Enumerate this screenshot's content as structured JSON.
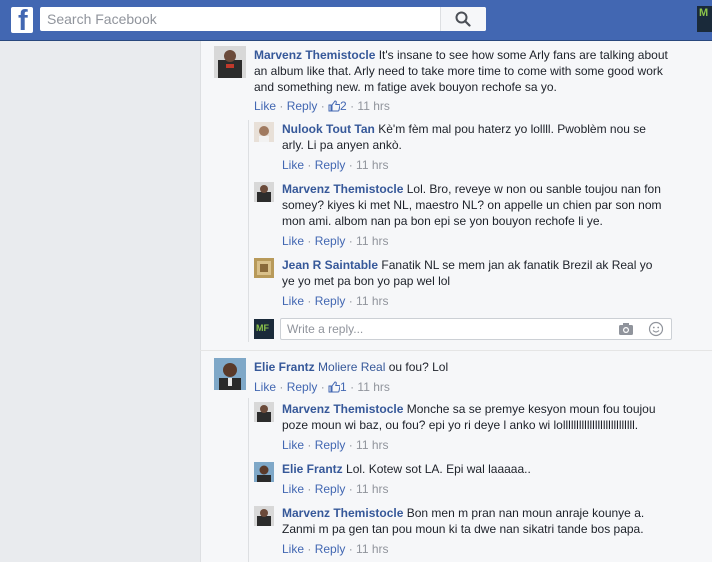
{
  "header": {
    "logo": "f",
    "search_placeholder": "Search Facebook",
    "profile_text": "M"
  },
  "comments": [
    {
      "author": "Marvenz Themistocle",
      "text": "It's insane to see how some Arly fans are talking about an album like that. Arly need to take more time to come with some good work and something new. m fatige avek bouyon rechofe sa yo.",
      "like": "Like",
      "reply": "Reply",
      "reactions": "2",
      "time": "11 hrs"
    },
    {
      "author": "Nulook Tout Tan",
      "text": "Kè'm fèm mal pou haterz yo lollll. Pwoblèm nou se arly. Li pa anyen ankò.",
      "like": "Like",
      "reply": "Reply",
      "time": "11 hrs"
    },
    {
      "author": "Marvenz Themistocle",
      "text": "Lol. Bro, reveye w non ou sanble toujou nan fon somey? kiyes ki met NL, maestro NL? on appelle un chien par son nom mon ami. albom nan pa bon epi se yon bouyon rechofe li ye.",
      "like": "Like",
      "reply": "Reply",
      "time": "11 hrs"
    },
    {
      "author": "Jean R Saintable",
      "text": "Fanatik NL se mem jan ak fanatik Brezil ak Real yo ye yo met pa bon yo pap wel lol",
      "like": "Like",
      "reply": "Reply",
      "time": "11 hrs"
    },
    {
      "author": "Elie Frantz",
      "tag": "Moliere Real",
      "text": "ou fou? Lol",
      "like": "Like",
      "reply": "Reply",
      "reactions": "1",
      "time": "11 hrs"
    },
    {
      "author": "Marvenz Themistocle",
      "text": "Monche sa se premye kesyon moun fou toujou poze moun wi baz, ou fou? epi yo ri deye l anko wi lolllllllllllllllllllllllllll.",
      "like": "Like",
      "reply": "Reply",
      "time": "11 hrs"
    },
    {
      "author": "Elie Frantz",
      "text": "Lol. Kotew sot LA. Epi wal laaaaa..",
      "like": "Like",
      "reply": "Reply",
      "time": "11 hrs"
    },
    {
      "author": "Marvenz Themistocle",
      "text": "Bon men m pran nan moun anraje kounye a. Zanmi m pa gen tan pou moun ki ta dwe nan sikatri tande bos papa.",
      "like": "Like",
      "reply": "Reply",
      "time": "11 hrs"
    }
  ],
  "reply_box": {
    "placeholder": "Write a reply...",
    "avatar_text": "MF"
  },
  "icons": {
    "logo": "facebook-logo",
    "search": "search-icon",
    "like": "thumbs-up-icon",
    "camera": "camera-icon",
    "emoji": "smiley-icon"
  },
  "colors": {
    "topbar": "#4267b2",
    "author": "#365899",
    "link": "#4267b2",
    "meta": "#90949c"
  }
}
